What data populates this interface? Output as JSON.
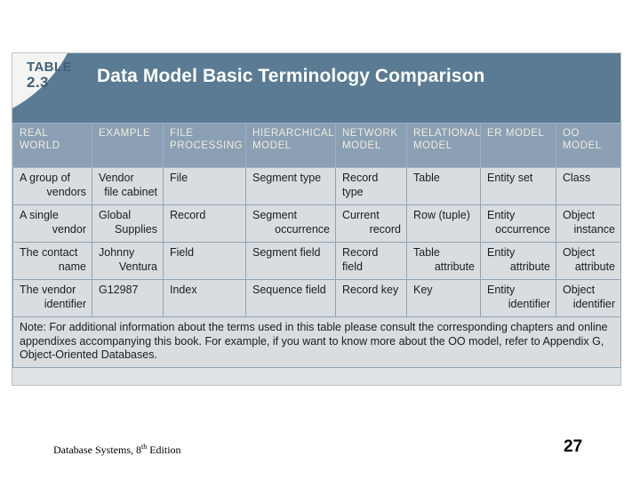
{
  "slide": {
    "footer_title_main": "Database Systems, 8",
    "footer_title_sup": "th",
    "footer_title_tail": " Edition",
    "page_number": "27"
  },
  "table": {
    "label_word": "TABLE",
    "label_number": "2.3",
    "title": "Data Model Basic Terminology Comparison",
    "colors": {
      "banner": "#5a7b93",
      "header_row": "#8ba0b4",
      "cell": "#d9dde0",
      "frame": "#dfe3e6",
      "grid_line": "#8fa4b5",
      "label_text": "#3f6079",
      "header_text": "#f0ece0"
    },
    "columns": [
      {
        "line1": "REAL",
        "line2": "WORLD"
      },
      {
        "line1": "EXAMPLE",
        "line2": ""
      },
      {
        "line1": "FILE",
        "line2": "PROCESSING"
      },
      {
        "line1": "HIERARCHICAL",
        "line2": "MODEL"
      },
      {
        "line1": "NETWORK",
        "line2": "MODEL"
      },
      {
        "line1": "RELATIONAL",
        "line2": "MODEL"
      },
      {
        "line1": "ER MODEL",
        "line2": ""
      },
      {
        "line1": "OO",
        "line2": "MODEL"
      }
    ],
    "rows": [
      {
        "real_world": {
          "l1": "A group of",
          "l2": "vendors"
        },
        "example": {
          "l1": "Vendor",
          "l2": "file cabinet"
        },
        "file": {
          "l1": "File",
          "l2": ""
        },
        "hierarchical": {
          "l1": "Segment type",
          "l2": ""
        },
        "network": {
          "l1": "Record type",
          "l2": ""
        },
        "relational": {
          "l1": "Table",
          "l2": ""
        },
        "er": {
          "l1": "Entity set",
          "l2": ""
        },
        "oo": {
          "l1": "Class",
          "l2": ""
        }
      },
      {
        "real_world": {
          "l1": "A single",
          "l2": "vendor"
        },
        "example": {
          "l1": "Global",
          "l2": "Supplies"
        },
        "file": {
          "l1": "Record",
          "l2": ""
        },
        "hierarchical": {
          "l1": "Segment",
          "l2": "occurrence"
        },
        "network": {
          "l1": "Current",
          "l2": "record"
        },
        "relational": {
          "l1": "Row (tuple)",
          "l2": ""
        },
        "er": {
          "l1": "Entity",
          "l2": "occurrence"
        },
        "oo": {
          "l1": "Object",
          "l2": "instance"
        }
      },
      {
        "real_world": {
          "l1": "The contact",
          "l2": "name"
        },
        "example": {
          "l1": "Johnny",
          "l2": "Ventura"
        },
        "file": {
          "l1": "Field",
          "l2": ""
        },
        "hierarchical": {
          "l1": "Segment field",
          "l2": ""
        },
        "network": {
          "l1": "Record field",
          "l2": ""
        },
        "relational": {
          "l1": "Table",
          "l2": "attribute"
        },
        "er": {
          "l1": "Entity",
          "l2": "attribute"
        },
        "oo": {
          "l1": "Object",
          "l2": "attribute"
        }
      },
      {
        "real_world": {
          "l1": "The vendor",
          "l2": "identifier"
        },
        "example": {
          "l1": "G12987",
          "l2": ""
        },
        "file": {
          "l1": "Index",
          "l2": ""
        },
        "hierarchical": {
          "l1": "Sequence field",
          "l2": ""
        },
        "network": {
          "l1": "Record key",
          "l2": ""
        },
        "relational": {
          "l1": "Key",
          "l2": ""
        },
        "er": {
          "l1": "Entity",
          "l2": "identifier"
        },
        "oo": {
          "l1": "Object",
          "l2": "identifier"
        }
      }
    ],
    "note": "Note: For additional information about the terms used in this table please consult the corresponding chapters and online appendixes accompanying this book. For example, if you want to know more about the OO model, refer to Appendix G, Object-Oriented Databases."
  }
}
